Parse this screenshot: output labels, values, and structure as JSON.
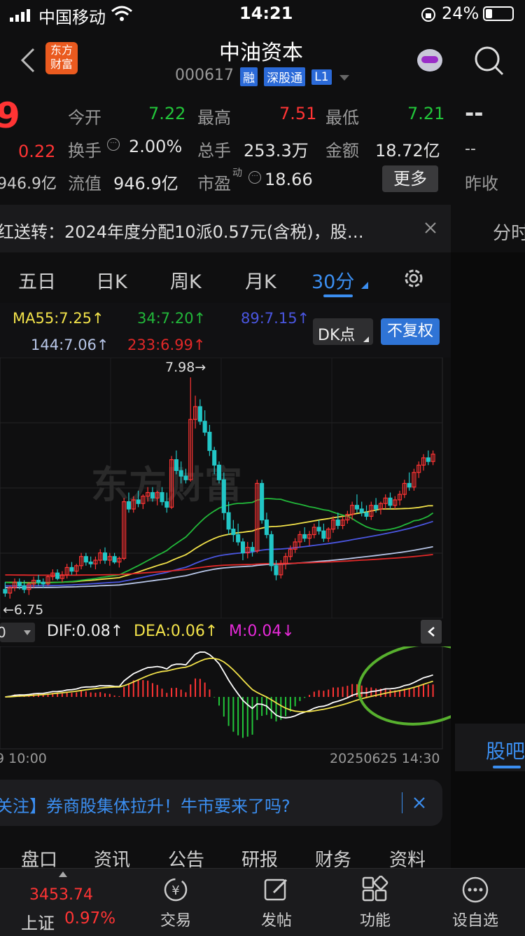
{
  "status_bar": {
    "carrier": "中国移动",
    "time": "14:21",
    "battery": "24%"
  },
  "header": {
    "title": "中油资本",
    "code": "000617",
    "badges": [
      "融",
      "深股通",
      "L1"
    ],
    "logo_line1": "东方",
    "logo_line2": "财富"
  },
  "quote": {
    "price_partial": "9",
    "change_partial": "0.22",
    "cap_partial": "946.9亿",
    "labels": {
      "open": "今开",
      "high": "最高",
      "low": "最低",
      "turnover": "换手",
      "volume": "总手",
      "amount": "金额",
      "float_value": "流值",
      "pe": "市盈",
      "pe_sup": "动",
      "prev_close": "昨收"
    },
    "values": {
      "open": "7.22",
      "high": "7.51",
      "low": "7.21",
      "turnover": "2.00%",
      "volume": "253.3万",
      "amount": "18.72亿",
      "float_value": "946.9亿",
      "pe": "18.66",
      "price_dash": "--",
      "prev_close_dash": "--"
    },
    "more_button": "更多"
  },
  "notice": {
    "text": "红送转：2024年度分配10派0.57元(含税)，股…",
    "side_tab": "分时"
  },
  "chart_tabs": [
    "五日",
    "日K",
    "周K",
    "月K",
    "30分"
  ],
  "ma_legend": {
    "ma55": "MA55:7.25↑",
    "ma34": "34:7.20↑",
    "ma89": "89:7.15↑",
    "ma144": "144:7.06↑",
    "ma233": "233:6.99↑"
  },
  "buttons": {
    "dk": "DK点",
    "fuquan": "不复权"
  },
  "chart_annotations": {
    "high": "7.98→",
    "low": "←6.75",
    "watermark": "东方财富"
  },
  "macd_legend": {
    "dif": "DIF:0.08↑",
    "dea": "DEA:0.06↑",
    "m": "M:0.04↓",
    "select": "0"
  },
  "time_axis": {
    "left": "9 10:00",
    "right": "20250625 14:30"
  },
  "guba_tab": "股吧",
  "news_banner": {
    "text": "关注】券商股集体拉升！牛市要来了吗?"
  },
  "bottom_tabs": [
    "盘口",
    "资讯",
    "公告",
    "研报",
    "财务",
    "资料"
  ],
  "bottom_nav": {
    "index_value": "3453.74",
    "index_name": "上证",
    "index_change": "0.97%",
    "items": [
      "交易",
      "发帖",
      "功能",
      "设自选"
    ]
  },
  "colors": {
    "up": "#ff3434",
    "down": "#22c6c6",
    "ma55": "#f2e24a",
    "ma34": "#22b83a",
    "ma89": "#4a56e0",
    "ma144": "#b8c6e8",
    "ma233": "#e02828",
    "accent": "#3b8ef0"
  },
  "chart_data": {
    "type": "candlestick",
    "price_range": [
      6.7,
      8.05
    ],
    "candles": [
      [
        6.82,
        6.86,
        6.78,
        6.8
      ],
      [
        6.8,
        6.84,
        6.77,
        6.83
      ],
      [
        6.83,
        6.88,
        6.81,
        6.86
      ],
      [
        6.86,
        6.88,
        6.82,
        6.84
      ],
      [
        6.84,
        6.87,
        6.8,
        6.82
      ],
      [
        6.82,
        6.86,
        6.79,
        6.85
      ],
      [
        6.85,
        6.89,
        6.83,
        6.87
      ],
      [
        6.87,
        6.9,
        6.84,
        6.86
      ],
      [
        6.86,
        6.88,
        6.83,
        6.85
      ],
      [
        6.85,
        6.9,
        6.84,
        6.89
      ],
      [
        6.89,
        6.93,
        6.87,
        6.91
      ],
      [
        6.91,
        6.93,
        6.87,
        6.88
      ],
      [
        6.88,
        6.92,
        6.86,
        6.9
      ],
      [
        6.9,
        6.96,
        6.88,
        6.94
      ],
      [
        6.94,
        6.97,
        6.9,
        6.92
      ],
      [
        6.92,
        6.96,
        6.9,
        6.95
      ],
      [
        6.95,
        7.02,
        6.93,
        7.0
      ],
      [
        7.0,
        7.02,
        6.95,
        6.97
      ],
      [
        6.97,
        7.0,
        6.94,
        6.96
      ],
      [
        6.96,
        7.0,
        6.93,
        6.98
      ],
      [
        6.98,
        7.04,
        6.96,
        7.02
      ],
      [
        7.02,
        7.05,
        6.96,
        6.98
      ],
      [
        6.98,
        7.02,
        6.95,
        7.0
      ],
      [
        7.0,
        7.02,
        6.96,
        6.97
      ],
      [
        6.97,
        7.0,
        6.94,
        6.99
      ],
      [
        6.99,
        7.32,
        6.98,
        7.3
      ],
      [
        7.3,
        7.35,
        7.24,
        7.26
      ],
      [
        7.26,
        7.33,
        7.24,
        7.31
      ],
      [
        7.31,
        7.36,
        7.27,
        7.29
      ],
      [
        7.29,
        7.34,
        7.26,
        7.33
      ],
      [
        7.33,
        7.38,
        7.3,
        7.35
      ],
      [
        7.35,
        7.38,
        7.3,
        7.32
      ],
      [
        7.32,
        7.36,
        7.28,
        7.35
      ],
      [
        7.35,
        7.38,
        7.28,
        7.3
      ],
      [
        7.3,
        7.35,
        7.24,
        7.27
      ],
      [
        7.27,
        7.55,
        7.26,
        7.53
      ],
      [
        7.53,
        7.58,
        7.45,
        7.47
      ],
      [
        7.47,
        7.52,
        7.4,
        7.44
      ],
      [
        7.44,
        7.48,
        7.4,
        7.42
      ],
      [
        7.42,
        7.98,
        7.41,
        7.75
      ],
      [
        7.75,
        7.88,
        7.7,
        7.82
      ],
      [
        7.82,
        7.86,
        7.72,
        7.74
      ],
      [
        7.74,
        7.8,
        7.66,
        7.68
      ],
      [
        7.68,
        7.72,
        7.55,
        7.58
      ],
      [
        7.58,
        7.6,
        7.45,
        7.5
      ],
      [
        7.5,
        7.52,
        7.4,
        7.42
      ],
      [
        7.42,
        7.46,
        7.2,
        7.24
      ],
      [
        7.24,
        7.3,
        7.12,
        7.15
      ],
      [
        7.15,
        7.2,
        7.08,
        7.12
      ],
      [
        7.12,
        7.18,
        7.06,
        7.08
      ],
      [
        7.08,
        7.1,
        6.98,
        7.02
      ],
      [
        7.02,
        7.08,
        6.99,
        7.05
      ],
      [
        7.05,
        7.08,
        7.0,
        7.03
      ],
      [
        7.03,
        7.42,
        7.02,
        7.4
      ],
      [
        7.4,
        7.42,
        7.18,
        7.2
      ],
      [
        7.2,
        7.24,
        7.1,
        7.12
      ],
      [
        7.12,
        7.14,
        6.92,
        6.95
      ],
      [
        6.95,
        6.98,
        6.87,
        6.9
      ],
      [
        6.9,
        6.98,
        6.88,
        6.96
      ],
      [
        6.96,
        7.02,
        6.93,
        7.0
      ],
      [
        7.0,
        7.06,
        6.98,
        7.04
      ],
      [
        7.04,
        7.1,
        7.02,
        7.08
      ],
      [
        7.08,
        7.14,
        7.05,
        7.12
      ],
      [
        7.12,
        7.16,
        7.08,
        7.1
      ],
      [
        7.1,
        7.14,
        7.06,
        7.12
      ],
      [
        7.12,
        7.18,
        7.1,
        7.16
      ],
      [
        7.16,
        7.2,
        7.12,
        7.14
      ],
      [
        7.14,
        7.18,
        7.08,
        7.1
      ],
      [
        7.1,
        7.16,
        7.08,
        7.15
      ],
      [
        7.15,
        7.22,
        7.13,
        7.2
      ],
      [
        7.2,
        7.24,
        7.15,
        7.17
      ],
      [
        7.17,
        7.22,
        7.15,
        7.2
      ],
      [
        7.2,
        7.25,
        7.18,
        7.23
      ],
      [
        7.23,
        7.3,
        7.2,
        7.28
      ],
      [
        7.28,
        7.34,
        7.24,
        7.26
      ],
      [
        7.26,
        7.3,
        7.22,
        7.24
      ],
      [
        7.24,
        7.28,
        7.2,
        7.22
      ],
      [
        7.22,
        7.3,
        7.2,
        7.28
      ],
      [
        7.28,
        7.32,
        7.24,
        7.26
      ],
      [
        7.26,
        7.3,
        7.23,
        7.29
      ],
      [
        7.29,
        7.34,
        7.26,
        7.32
      ],
      [
        7.32,
        7.35,
        7.26,
        7.28
      ],
      [
        7.28,
        7.33,
        7.26,
        7.31
      ],
      [
        7.31,
        7.36,
        7.28,
        7.34
      ],
      [
        7.34,
        7.42,
        7.32,
        7.4
      ],
      [
        7.4,
        7.46,
        7.36,
        7.38
      ],
      [
        7.38,
        7.48,
        7.36,
        7.46
      ],
      [
        7.46,
        7.52,
        7.43,
        7.5
      ],
      [
        7.5,
        7.56,
        7.47,
        7.54
      ],
      [
        7.54,
        7.58,
        7.5,
        7.52
      ],
      [
        7.52,
        7.58,
        7.5,
        7.56
      ]
    ]
  }
}
